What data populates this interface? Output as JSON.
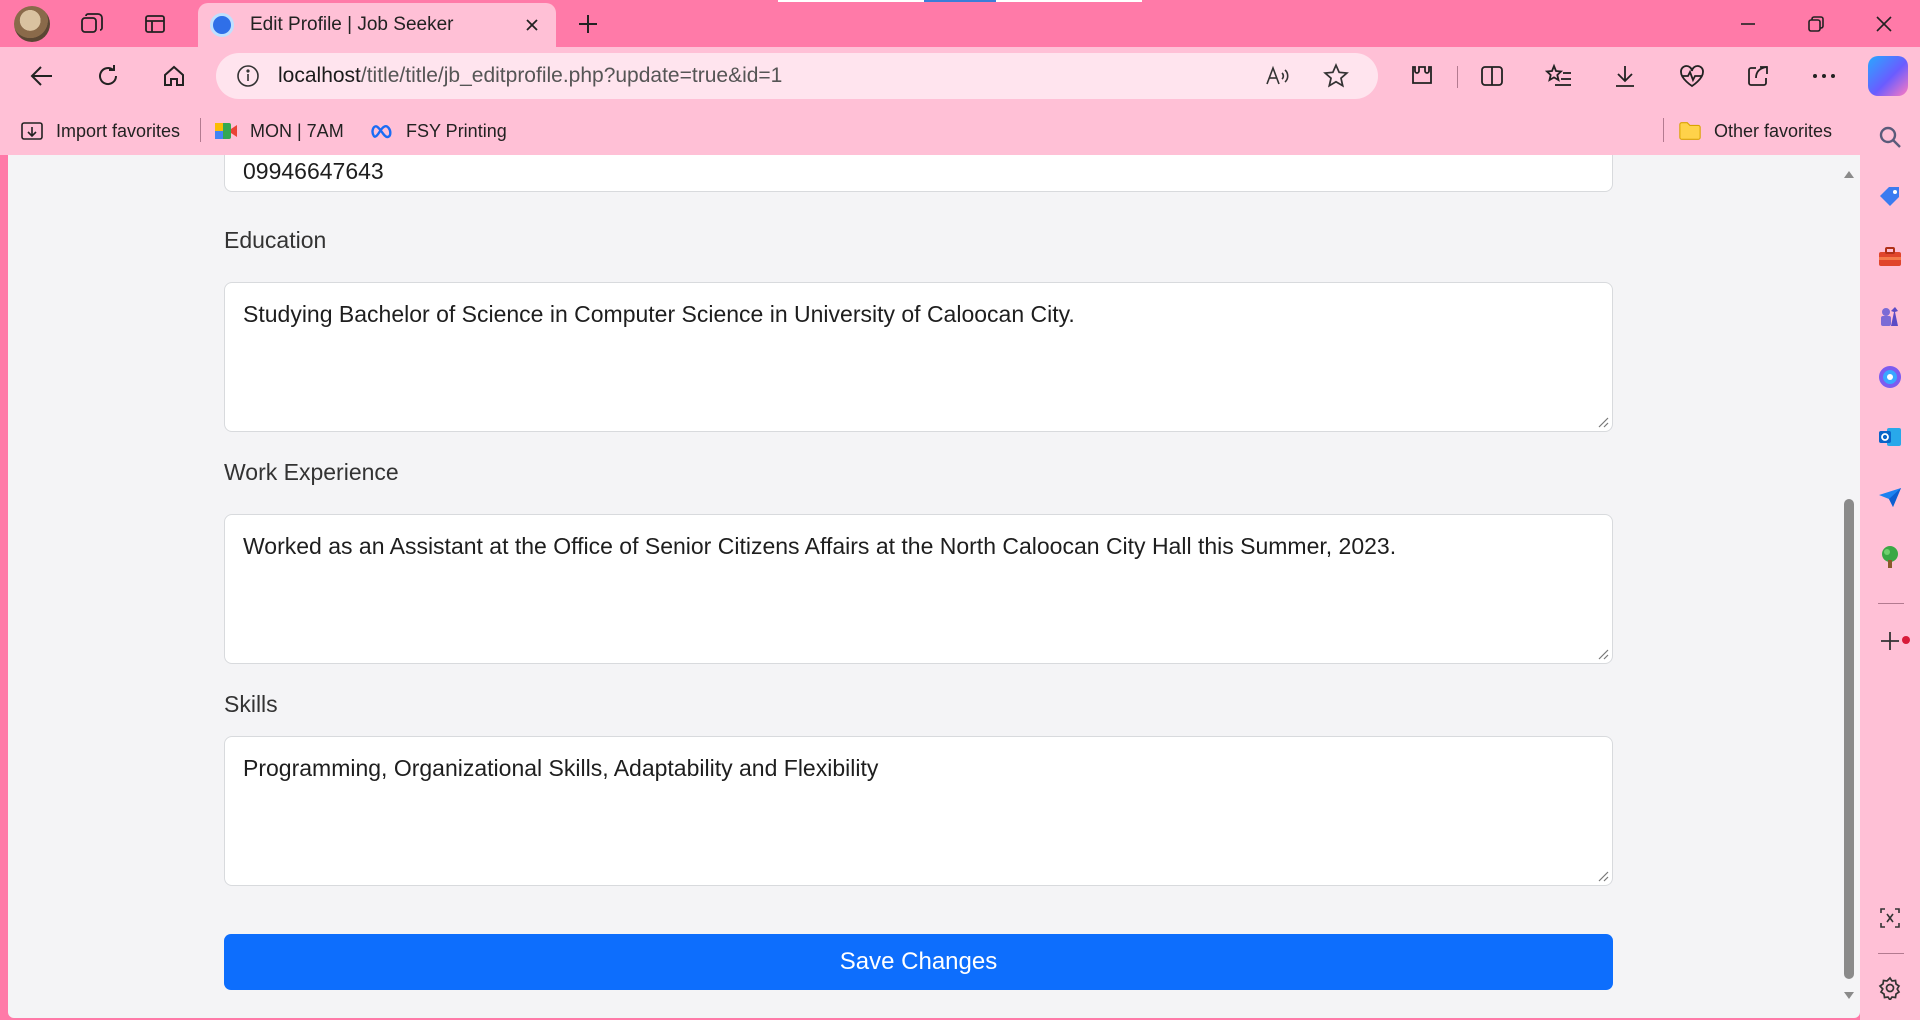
{
  "browser": {
    "tab_title": "Edit Profile | Job Seeker",
    "url_host": "localhost",
    "url_path": "/title/title/jb_editprofile.php?update=true&id=1"
  },
  "favorites": {
    "import": "Import favorites",
    "item1": "MON | 7AM",
    "item2": "FSY Printing",
    "other": "Other favorites"
  },
  "form": {
    "phone_value": "09946647643",
    "education_label": "Education",
    "education_value": "Studying Bachelor of Science in Computer Science in University of Caloocan City.",
    "work_label": "Work Experience",
    "work_value": "Worked as an Assistant at the Office of Senior Citizens Affairs at the North Caloocan City Hall this Summer, 2023.",
    "skills_label": "Skills",
    "skills_value": "Programming, Organizational Skills, Adaptability and Flexibility",
    "save_label": "Save Changes"
  },
  "colors": {
    "browser_chrome": "#ff7aa8",
    "toolbar": "#ffc0d6",
    "primary_button": "#0d6efd",
    "page_background": "#f4f4f6"
  },
  "icons": [
    "profile-avatar",
    "workspaces-icon",
    "tab-actions-icon",
    "close-icon",
    "plus-icon",
    "minimize-icon",
    "restore-icon",
    "back-icon",
    "refresh-icon",
    "home-icon",
    "info-icon",
    "read-aloud-icon",
    "star-icon",
    "extensions-icon",
    "split-screen-icon",
    "favorites-icon",
    "download-icon",
    "browser-essentials-icon",
    "share-icon",
    "more-icon",
    "copilot-icon",
    "search-icon",
    "shopping-icon",
    "tools-icon",
    "games-icon",
    "copilot-app-icon",
    "outlook-icon",
    "send-icon",
    "tree-icon",
    "add-icon",
    "screenshot-icon",
    "settings-icon"
  ]
}
